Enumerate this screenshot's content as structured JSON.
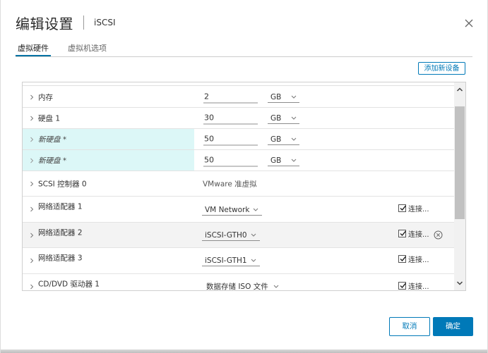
{
  "dialog": {
    "title": "编辑设置",
    "subtitle": "iSCSI",
    "close_icon": "close-icon"
  },
  "tabs": [
    {
      "label": "虚拟硬件",
      "active": true
    },
    {
      "label": "虚拟机选项",
      "active": false
    }
  ],
  "toolbar": {
    "add_device_label": "添加新设备"
  },
  "rows": {
    "memory": {
      "name": "内存",
      "value": "2",
      "unit": "GB"
    },
    "hdd1": {
      "name": "硬盘 1",
      "value": "30",
      "unit": "GB"
    },
    "newdisk1": {
      "name": "新硬盘 *",
      "value": "50",
      "unit": "GB"
    },
    "newdisk2": {
      "name": "新硬盘 *",
      "value": "50",
      "unit": "GB"
    },
    "scsi": {
      "name": "SCSI 控制器 0",
      "value": "VMware 准虚拟"
    },
    "net1": {
      "name": "网络适配器 1",
      "network": "VM Network",
      "connect_label": "连接...",
      "connected": true
    },
    "net2": {
      "name": "网络适配器 2",
      "network": "iSCSI-GTH0",
      "connect_label": "连接...",
      "connected": true
    },
    "net3": {
      "name": "网络适配器 3",
      "network": "iSCSI-GTH1",
      "connect_label": "连接...",
      "connected": true
    },
    "cd": {
      "name": "CD/DVD 驱动器 1",
      "media": "数据存储 ISO 文件",
      "connect_label": "连接...",
      "connected": true
    }
  },
  "footer": {
    "cancel_label": "取消",
    "ok_label": "确定"
  },
  "colors": {
    "accent": "#0079b8",
    "new_row_highlight": "#dcf7f7"
  }
}
